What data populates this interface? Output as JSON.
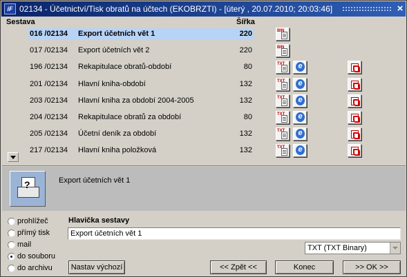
{
  "window": {
    "title": "02134 - Účetnictví/Tisk obratů na účtech (EKOBRZTI) - [úterý , 20.07.2010; 20:03:46]",
    "app_icon_text": "iF",
    "close_glyph": "×"
  },
  "list": {
    "headers": {
      "sestava": "Sestava",
      "sirka": "Šířka"
    },
    "rows": [
      {
        "code": "016 /02134",
        "name": "Export účetních vět 1",
        "width": "220",
        "formats": [
          "BIN"
        ],
        "selected": true
      },
      {
        "code": "017 /02134",
        "name": "Export účetních vět 2",
        "width": "220",
        "formats": [
          "BIN"
        ]
      },
      {
        "code": "196 /02134",
        "name": "Rekapitulace obratů-období",
        "width": "80",
        "formats": [
          "TXT",
          "IE",
          "PDF"
        ]
      },
      {
        "code": "201 /02134",
        "name": "Hlavní kniha-období",
        "width": "132",
        "formats": [
          "TXT",
          "IE",
          "PDF"
        ]
      },
      {
        "code": "203 /02134",
        "name": "Hlavní kniha za období 2004-2005",
        "width": "132",
        "formats": [
          "TXT",
          "IE",
          "PDF"
        ]
      },
      {
        "code": "204 /02134",
        "name": "Rekapitulace obratů za období",
        "width": "80",
        "formats": [
          "TXT",
          "IE",
          "PDF"
        ]
      },
      {
        "code": "205 /02134",
        "name": "Účetní deník za období",
        "width": "132",
        "formats": [
          "TXT",
          "IE",
          "PDF"
        ]
      },
      {
        "code": "217 /02134",
        "name": "Hlavní kniha položková",
        "width": "132",
        "formats": [
          "TXT",
          "IE",
          "PDF"
        ]
      }
    ]
  },
  "preview": {
    "report_name": "Export účetních vět 1"
  },
  "output": {
    "options": [
      {
        "label": "prohlížeč",
        "checked": false
      },
      {
        "label": "přímý tisk",
        "checked": false
      },
      {
        "label": "mail",
        "checked": false
      },
      {
        "label": "do souboru",
        "checked": true
      },
      {
        "label": "do archivu",
        "checked": false
      }
    ]
  },
  "header_field": {
    "label": "Hlavička sestavy",
    "value": "Export účetních vět 1"
  },
  "format": {
    "selected": "TXT (TXT Binary)"
  },
  "buttons": {
    "defaults": "Nastav výchozí",
    "back": "<< Zpět <<",
    "end": "Konec",
    "ok": ">> OK >>"
  }
}
